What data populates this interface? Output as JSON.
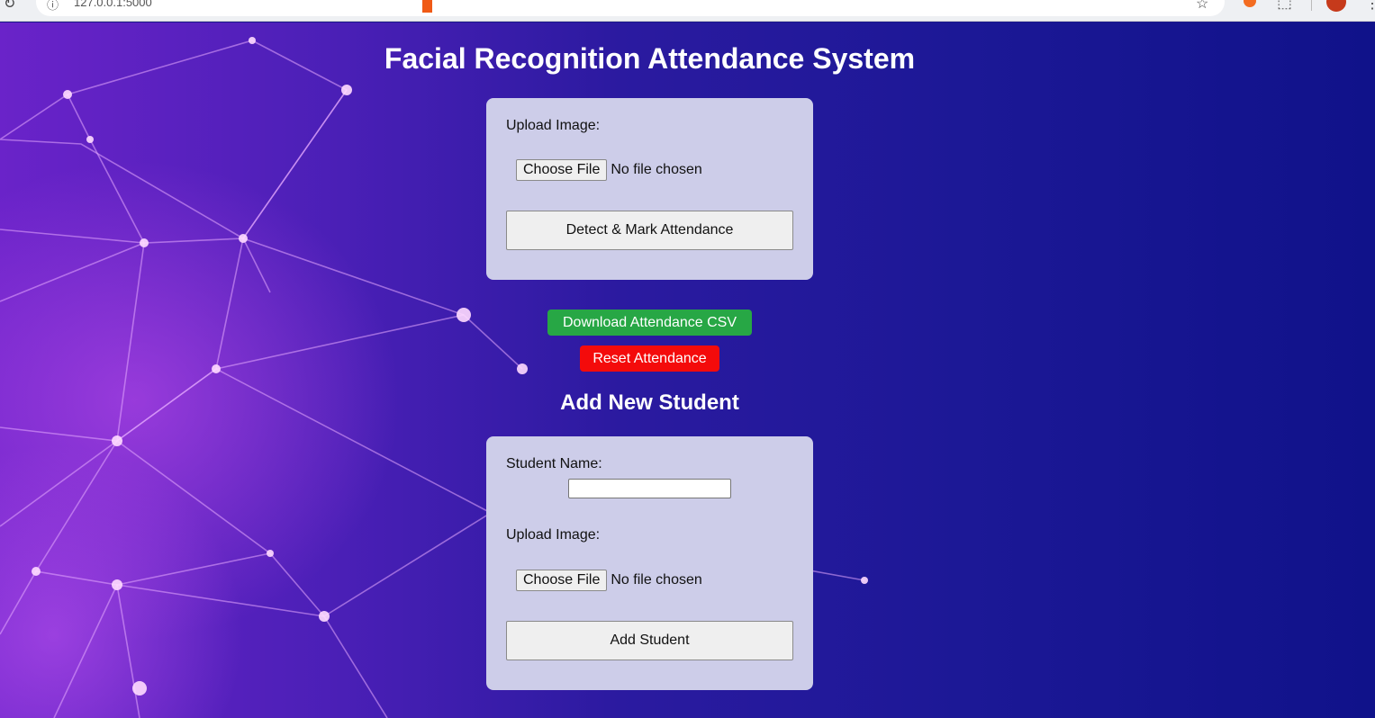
{
  "browser": {
    "url": "127.0.0.1:5000",
    "reload_icon": "↻",
    "site_info_icon": "ⓘ",
    "star_icon": "☆",
    "extension_icon": "⬚",
    "menu_icon": "⋮"
  },
  "page": {
    "title": "Facial Recognition Attendance System",
    "subtitle": "Add New Student"
  },
  "attendance_form": {
    "upload_label": "Upload Image:",
    "choose_file_label": "Choose File",
    "file_status": "No file chosen",
    "detect_button_label": "Detect & Mark Attendance"
  },
  "actions": {
    "download_label": "Download Attendance CSV",
    "reset_label": "Reset Attendance"
  },
  "student_form": {
    "name_label": "Student Name:",
    "name_value": "",
    "upload_label": "Upload Image:",
    "choose_file_label": "Choose File",
    "file_status": "No file chosen",
    "add_button_label": "Add Student"
  },
  "colors": {
    "download_button": "#27a745",
    "reset_button": "#f40b0b",
    "card_background": "#cdcde9"
  }
}
